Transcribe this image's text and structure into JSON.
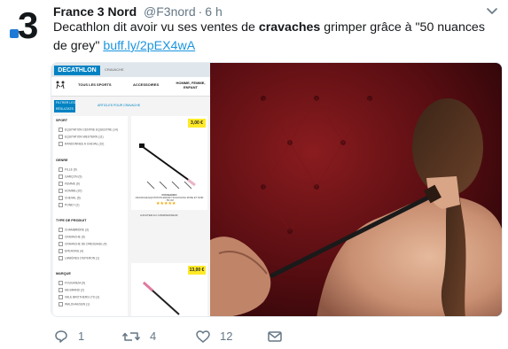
{
  "account": {
    "name": "France 3 Nord",
    "handle": "@F3nord",
    "separator": "·",
    "time": "6 h"
  },
  "avatar": {
    "label": "3",
    "accent": "#1f7ad6"
  },
  "tweet": {
    "text_before": "Decathlon dit avoir vu ses ventes de ",
    "text_bold": "cravaches",
    "text_after": " grimper grâce à \"50 nuances de grey\" ",
    "link": "buff.ly/2pEX4wA",
    "link_color": "#1b95e0"
  },
  "media": {
    "site": {
      "logo": "DECATHLON",
      "crumb": "CRAVACHE",
      "nav": [
        "TOUS LES SPORTS",
        "ACCESSOIRES",
        "HOMME, FEMME, ENFANT"
      ],
      "filter_button": "FILTRER LES RÉSULTATS",
      "result_count": "ARTICLES POUR CRAVACHE",
      "groups": [
        {
          "title": "SPORT",
          "items": [
            "EQUITATION CENTRE EQUESTRE (14)",
            "EQUITATION WESTERN (11)",
            "RANDONNEE A CHEVAL (10)"
          ]
        },
        {
          "title": "GENRE",
          "items": [
            "FILLE (9)",
            "GARÇON (9)",
            "FEMME (9)",
            "HOMME (20)",
            "CHEVAL (5)",
            "PONEY (2)"
          ]
        },
        {
          "title": "TYPE DE PRODUIT",
          "items": [
            "CHAMBRIÈRE (3)",
            "CRAVACHE (9)",
            "CRAVACHE DE DRESSAGE (4)",
            "EPERONS (4)",
            "LANIÈRES D'EPERON (1)"
          ]
        },
        {
          "title": "MARQUE",
          "items": [
            "FOUGANZA (9)",
            "HB BRAND (2)",
            "VALE BROTHERS LTD (2)",
            "WALDHAUSEN (1)"
          ]
        }
      ],
      "products": [
        {
          "price": "3,00 €",
          "brand": "FOUGANZA",
          "title": "CRAVACHE EQUITATION ENFANT SCHOOLING ROSE ET NOIR - 55 CM",
          "stars": "★★★★★",
          "reviews": "(11)",
          "compare": "AJOUTER AU COMPARATEUR"
        },
        {
          "price": "13,00 €",
          "brand": "",
          "title": "",
          "stars": "",
          "reviews": "",
          "compare": ""
        }
      ]
    }
  },
  "actions": {
    "reply_count": "1",
    "retweet_count": "4",
    "like_count": "12",
    "reply_color": "#657786",
    "retweet_color": "#657786",
    "like_color": "#657786"
  }
}
